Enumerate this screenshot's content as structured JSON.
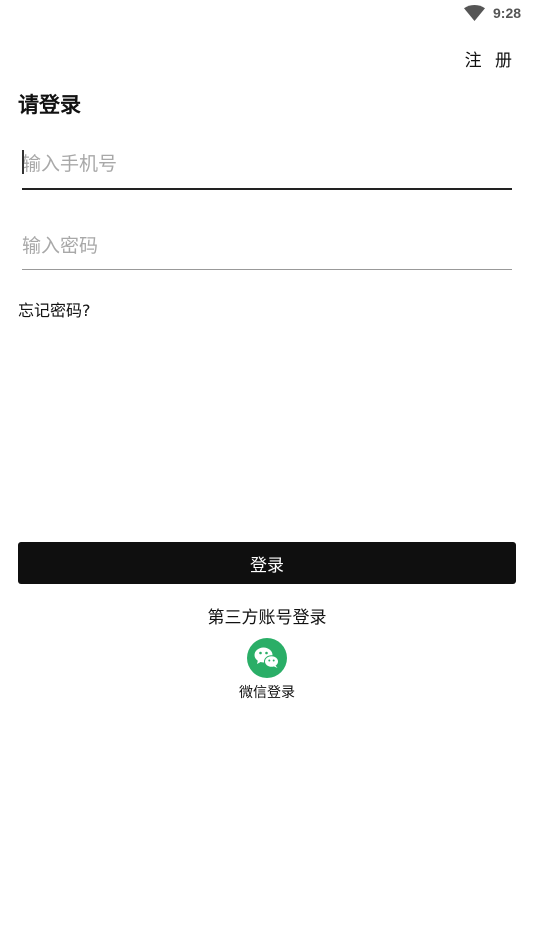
{
  "status_bar": {
    "time": "9:28",
    "icons": [
      "wifi-icon"
    ]
  },
  "header": {
    "register_label": "注 册"
  },
  "login": {
    "title": "请登录",
    "phone_placeholder": "输入手机号",
    "password_placeholder": "输入密码",
    "forgot_label": "忘记密码?",
    "submit_label": "登录"
  },
  "third_party": {
    "title": "第三方账号登录",
    "providers": [
      {
        "label": "微信登录",
        "icon": "wechat-icon",
        "color": "#2aae67"
      }
    ]
  },
  "colors": {
    "button_bg": "#0f0f0f",
    "wechat_green": "#2aae67"
  }
}
